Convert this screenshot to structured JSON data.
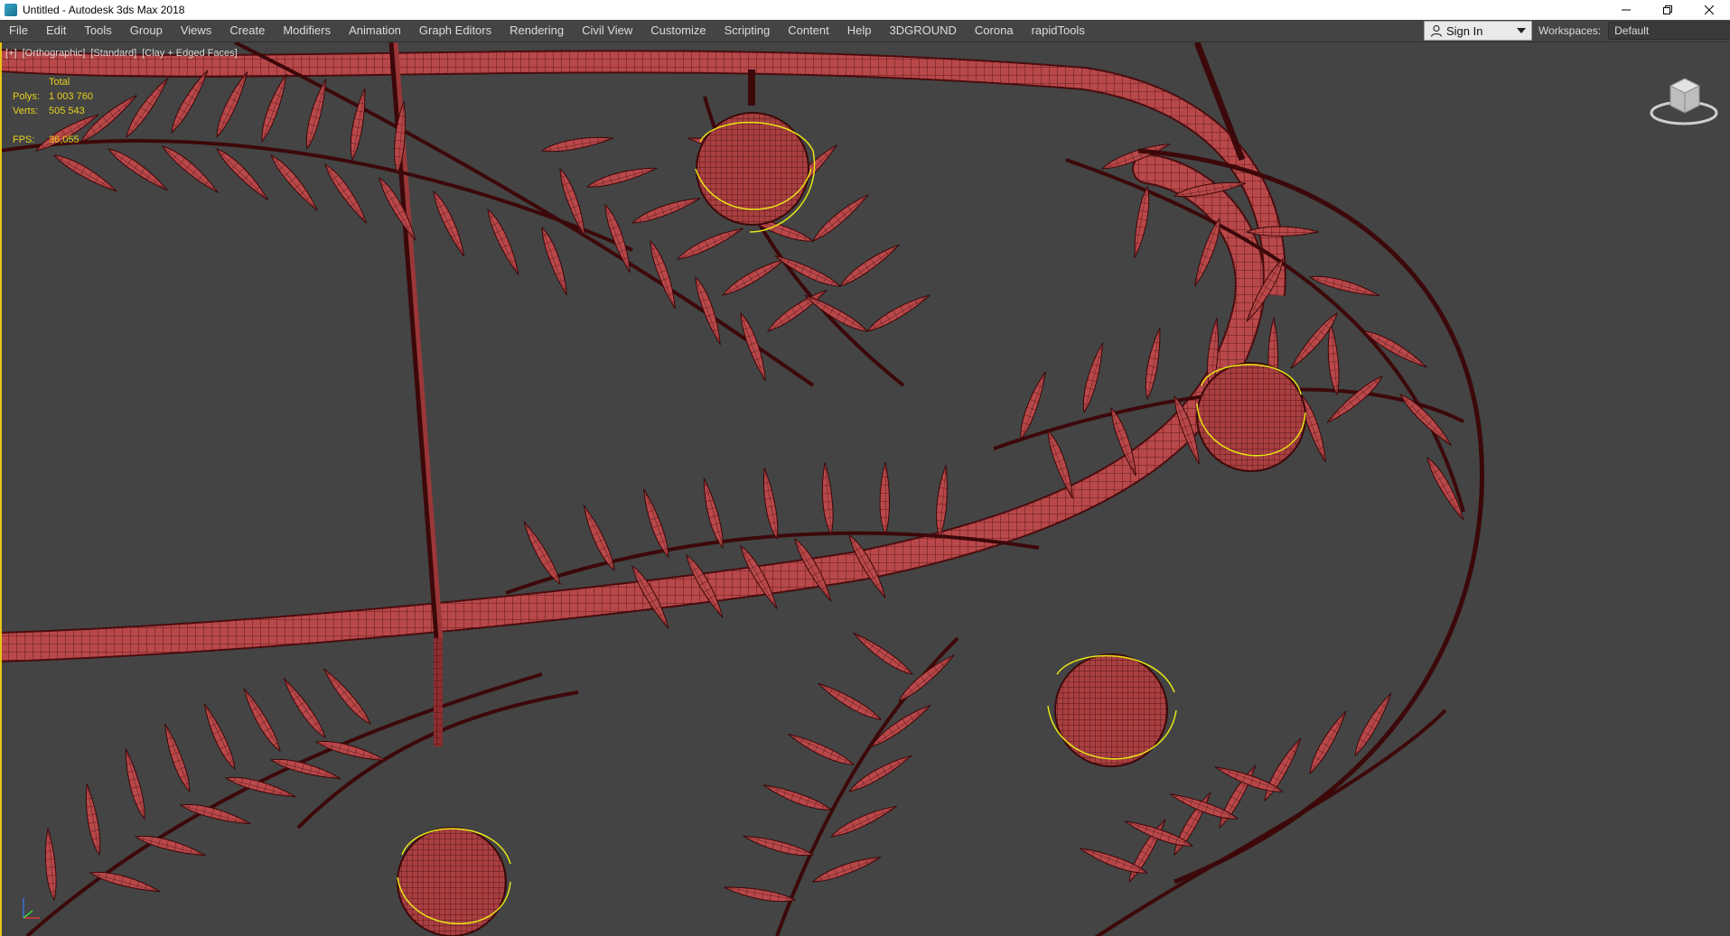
{
  "window": {
    "title": "Untitled - Autodesk 3ds Max 2018",
    "controls": [
      "minimize",
      "restore",
      "close"
    ]
  },
  "menu": {
    "items": [
      "File",
      "Edit",
      "Tools",
      "Group",
      "Views",
      "Create",
      "Modifiers",
      "Animation",
      "Graph Editors",
      "Rendering",
      "Civil View",
      "Customize",
      "Scripting",
      "Content",
      "Help",
      "3DGROUND",
      "Corona",
      "rapidTools"
    ]
  },
  "account": {
    "sign_in_label": "Sign In"
  },
  "workspaces": {
    "label": "Workspaces:",
    "selected": "Default"
  },
  "viewport": {
    "labels": [
      "[+]",
      "[Orthographic]",
      "[Standard]",
      "[Clay + Edged Faces]"
    ],
    "stats": {
      "header": "Total",
      "polys_label": "Polys:",
      "polys_value": "1 003 760",
      "verts_label": "Verts:",
      "verts_value": "505 543",
      "fps_label": "FPS:",
      "fps_value": "36,055"
    },
    "icons": {
      "viewcube": "viewcube-icon",
      "axis": "axis-tripod-icon"
    },
    "colors": {
      "background": "#444444",
      "model_fill": "#b8484a",
      "model_edge": "#4a0d0f",
      "selection": "#e6e617",
      "stats_text": "#e6d21a"
    }
  }
}
